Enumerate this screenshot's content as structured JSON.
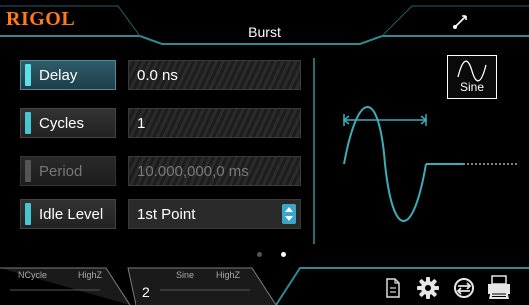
{
  "header": {
    "brand": "RIGOL",
    "title": "Burst"
  },
  "params": [
    {
      "label": "Delay",
      "value": "0.0 ns",
      "state": "selected"
    },
    {
      "label": "Cycles",
      "value": "1",
      "state": "normal"
    },
    {
      "label": "Period",
      "value": "10.000,000,0 ms",
      "state": "disabled"
    },
    {
      "label": "Idle Level",
      "value": "1st Point",
      "state": "normal"
    }
  ],
  "waveform": {
    "type_label": "Sine"
  },
  "pager": {
    "page_count": 2,
    "current": 2
  },
  "bottom_tabs": [
    {
      "mode": "NCycle",
      "load": "HighZ",
      "channel": ""
    },
    {
      "mode": "Sine",
      "load": "HighZ",
      "channel": "2"
    }
  ],
  "toolbar": {
    "icons": [
      "file-icon",
      "gear-icon",
      "utility-icon",
      "print-icon"
    ]
  },
  "colors": {
    "brand": "#ff7a1a",
    "accent": "#46c7d0",
    "waveform": "#3aaeb8"
  }
}
